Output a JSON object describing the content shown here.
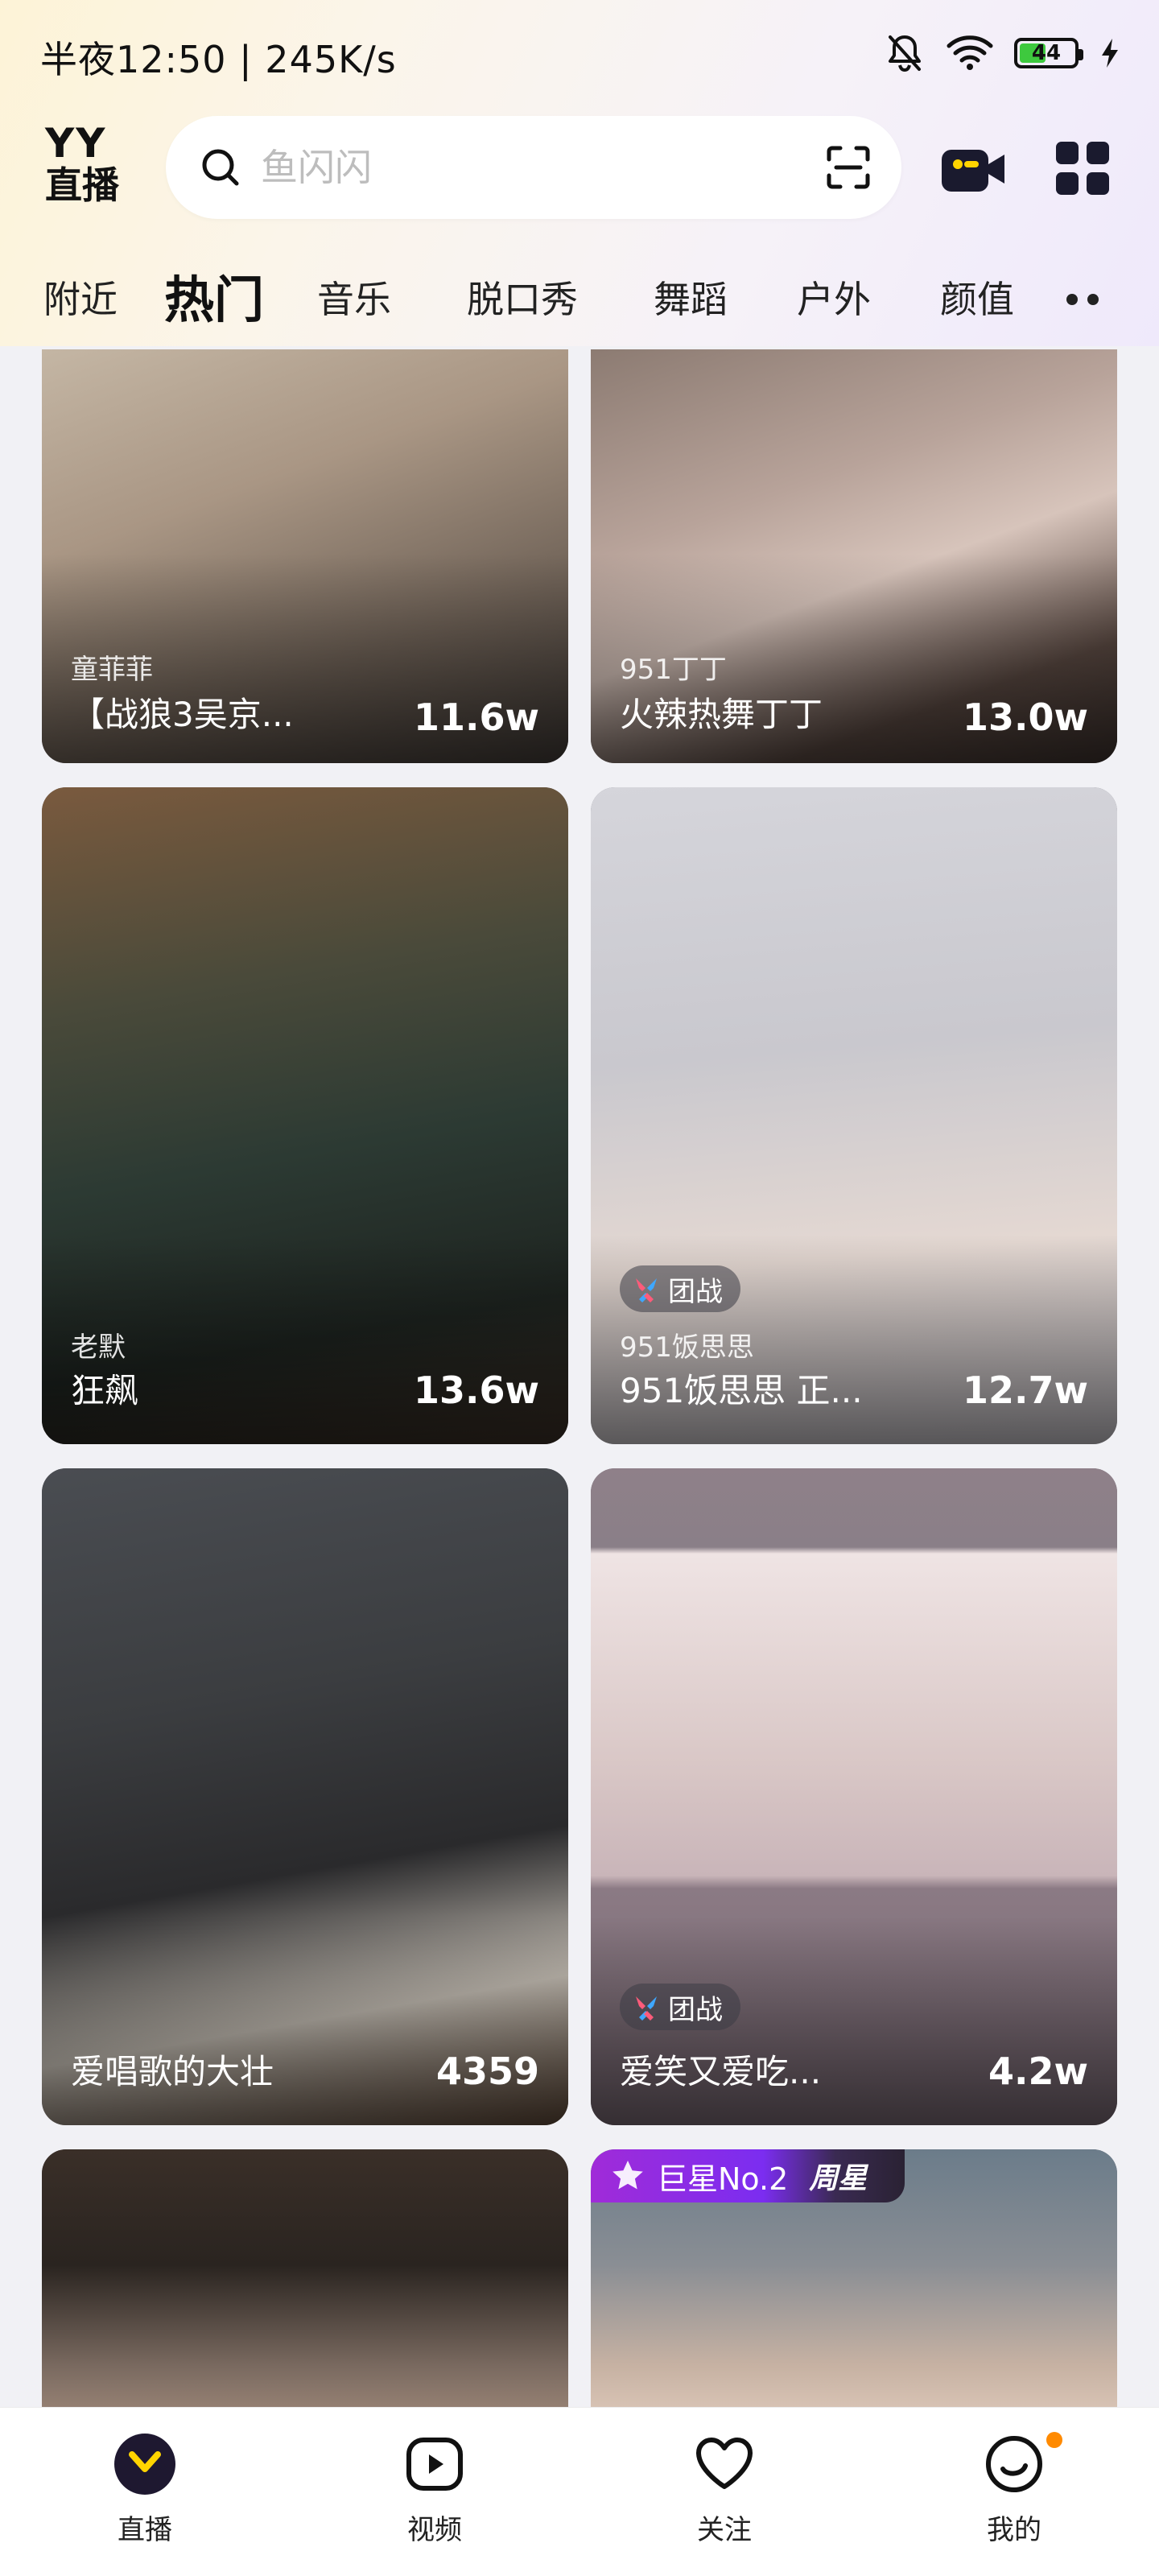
{
  "status_bar": {
    "time": "半夜12:50 | 245K/s",
    "battery": "44"
  },
  "header": {
    "logo_top": "YY",
    "logo_bottom": "直播",
    "search_placeholder": "鱼闪闪"
  },
  "tabs": [
    {
      "label": "附近",
      "active": false
    },
    {
      "label": "热门",
      "active": true
    },
    {
      "label": "音乐",
      "active": false
    },
    {
      "label": "脱口秀",
      "active": false
    },
    {
      "label": "舞蹈",
      "active": false
    },
    {
      "label": "户外",
      "active": false
    },
    {
      "label": "颜值",
      "active": false
    }
  ],
  "cards": [
    {
      "host": "童菲菲",
      "title": "【战狼3吴京...",
      "count": "11.6w"
    },
    {
      "host": "951丁丁",
      "title": "火辣热舞丁丁",
      "count": "13.0w"
    },
    {
      "host": "老默",
      "title": "狂飙",
      "count": "13.6w"
    },
    {
      "badge": "团战",
      "host": "951饭思思",
      "title": "951饭思思 正...",
      "count": "12.7w"
    },
    {
      "title": "爱唱歌的大壮",
      "count": "4359"
    },
    {
      "badge": "团战",
      "title": "爱笑又爱吃...",
      "count": "4.2w"
    },
    {},
    {
      "star_badge": "巨星No.2",
      "star_tag": "周星"
    }
  ],
  "bottom_nav": [
    {
      "label": "直播",
      "icon": "live-icon"
    },
    {
      "label": "视频",
      "icon": "video-icon"
    },
    {
      "label": "关注",
      "icon": "heart-icon"
    },
    {
      "label": "我的",
      "icon": "profile-icon"
    }
  ],
  "colors": {
    "brand_yellow": "#ffd400",
    "badge_purple": "#8a2be2",
    "notify_orange": "#ff8a00"
  }
}
